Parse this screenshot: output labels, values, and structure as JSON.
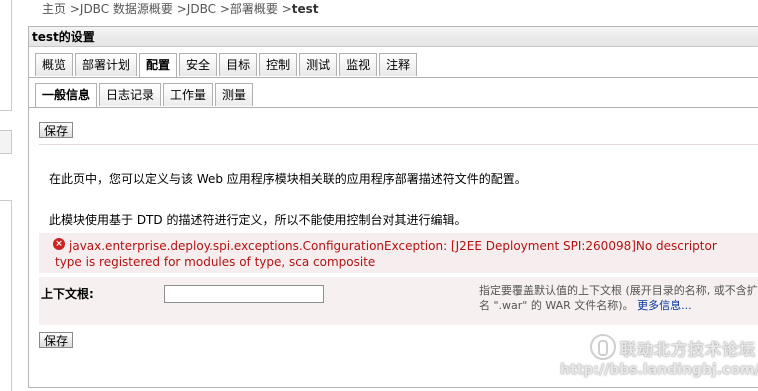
{
  "breadcrumb": {
    "items": [
      "主页",
      "JDBC 数据源概要",
      "JDBC",
      "部署概要",
      "test"
    ],
    "separator": ">"
  },
  "panel": {
    "title": "test的设置"
  },
  "main_tabs": [
    {
      "label": "概览"
    },
    {
      "label": "部署计划"
    },
    {
      "label": "配置",
      "active": true
    },
    {
      "label": "安全"
    },
    {
      "label": "目标"
    },
    {
      "label": "控制"
    },
    {
      "label": "测试"
    },
    {
      "label": "监视"
    },
    {
      "label": "注释"
    }
  ],
  "sub_tabs": [
    {
      "label": "一般信息",
      "active": true
    },
    {
      "label": "日志记录"
    },
    {
      "label": "工作量"
    },
    {
      "label": "测量"
    }
  ],
  "buttons": {
    "save_label": "保存"
  },
  "content": {
    "intro": "在此页中，您可以定义与该 Web 应用程序模块相关联的应用程序部署描述符文件的配置。",
    "dtd_note": "此模块使用基于 DTD 的描述符进行定义，所以不能使用控制台对其进行编辑。",
    "error_message": "javax.enterprise.deploy.spi.exceptions.ConfigurationException: [J2EE Deployment SPI:260098]No descriptor type is registered for modules of type, sca composite"
  },
  "context_root": {
    "label": "上下文根:",
    "value": "",
    "help_text": "指定要覆盖默认值的上下文根 (展开目录的名称, 或不含扩展名 \".war\" 的 WAR 文件名称)。",
    "more_link": "更多信息..."
  },
  "watermark": {
    "title": "联动北方技术论坛",
    "url": "http://bbs.landingbj.com/"
  },
  "colors": {
    "error_text": "#b31212",
    "link": "#003399",
    "error_bg": "#f6eeee"
  },
  "icons": {
    "error": "error-circle-icon"
  }
}
